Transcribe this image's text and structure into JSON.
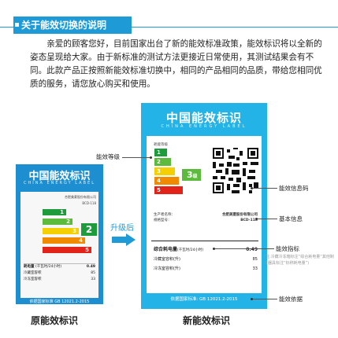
{
  "header": {
    "title": "关于能效切换的说明"
  },
  "intro": "亲爱的顾客您好，目前国家出台了新的能效标准政策，能效标识将以全新的姿态呈现给大家。由于新标准的测试方法更接近日常使用，其测试结果会有不同。此款产品正按照新能效标准切换中，相同的产品相同的品质，带给您相同优质的服务，请您放心购买和使用。",
  "upgrade_label": "升级后",
  "captions": {
    "old": "原能效标识",
    "new": "新能效标识"
  },
  "old_label": {
    "title": "中国能效标识",
    "subtitle": "CHINA ENERGY LABEL",
    "info": {
      "manufacturer": "合肥美菱股份有限公司",
      "model": "BCD-118"
    },
    "grade_number": "2",
    "bars": [
      "1",
      "2",
      "3",
      "4",
      "5"
    ],
    "metric_label": "耗电量",
    "metric_unit": "(千瓦时/24小时)",
    "metric_value": "0.49",
    "rows": [
      {
        "label": "冷藏室容积",
        "value": "85"
      },
      {
        "label": "冷冻室容积",
        "value": "33"
      }
    ],
    "footer": "依据国家标准 GB 12021.2-2015"
  },
  "new_label": {
    "title": "中国能效标识",
    "subtitle": "CHINA ENERGY LABEL",
    "level_heading": "耗能等级",
    "bars": [
      "1",
      "2",
      "3",
      "4",
      "5"
    ],
    "grade_badge": "3",
    "grade_unit": "级",
    "info": [
      {
        "label": "生产者名称：",
        "value": "合肥美菱股份有限公司"
      },
      {
        "label": "规格型号：",
        "value": "BCD-118"
      }
    ],
    "metric_label": "综合耗电量",
    "metric_unit": "(千瓦时/24小时)",
    "metric_value": "0.49",
    "rows": [
      {
        "label": "冷藏室容积(升)",
        "value": "85"
      },
      {
        "label": "冷冻室容积(升)",
        "value": "33"
      }
    ],
    "footer": "依据国家标准: GB 12021.2-2015"
  },
  "callouts": {
    "grade": "能效等级",
    "info_code": "能效信息码",
    "basic_info": "基本信息",
    "indicator": "能效指标",
    "indicator_note": "(注:冷藏冷冻箱标注“综合耗电量”其他制冷器具标注“标称耗电量”)",
    "basis": "能效依据"
  },
  "colors": {
    "accent": "#1e9ad6",
    "label_blue": "#24b3e6",
    "grade_green": "#5cbb3c"
  }
}
